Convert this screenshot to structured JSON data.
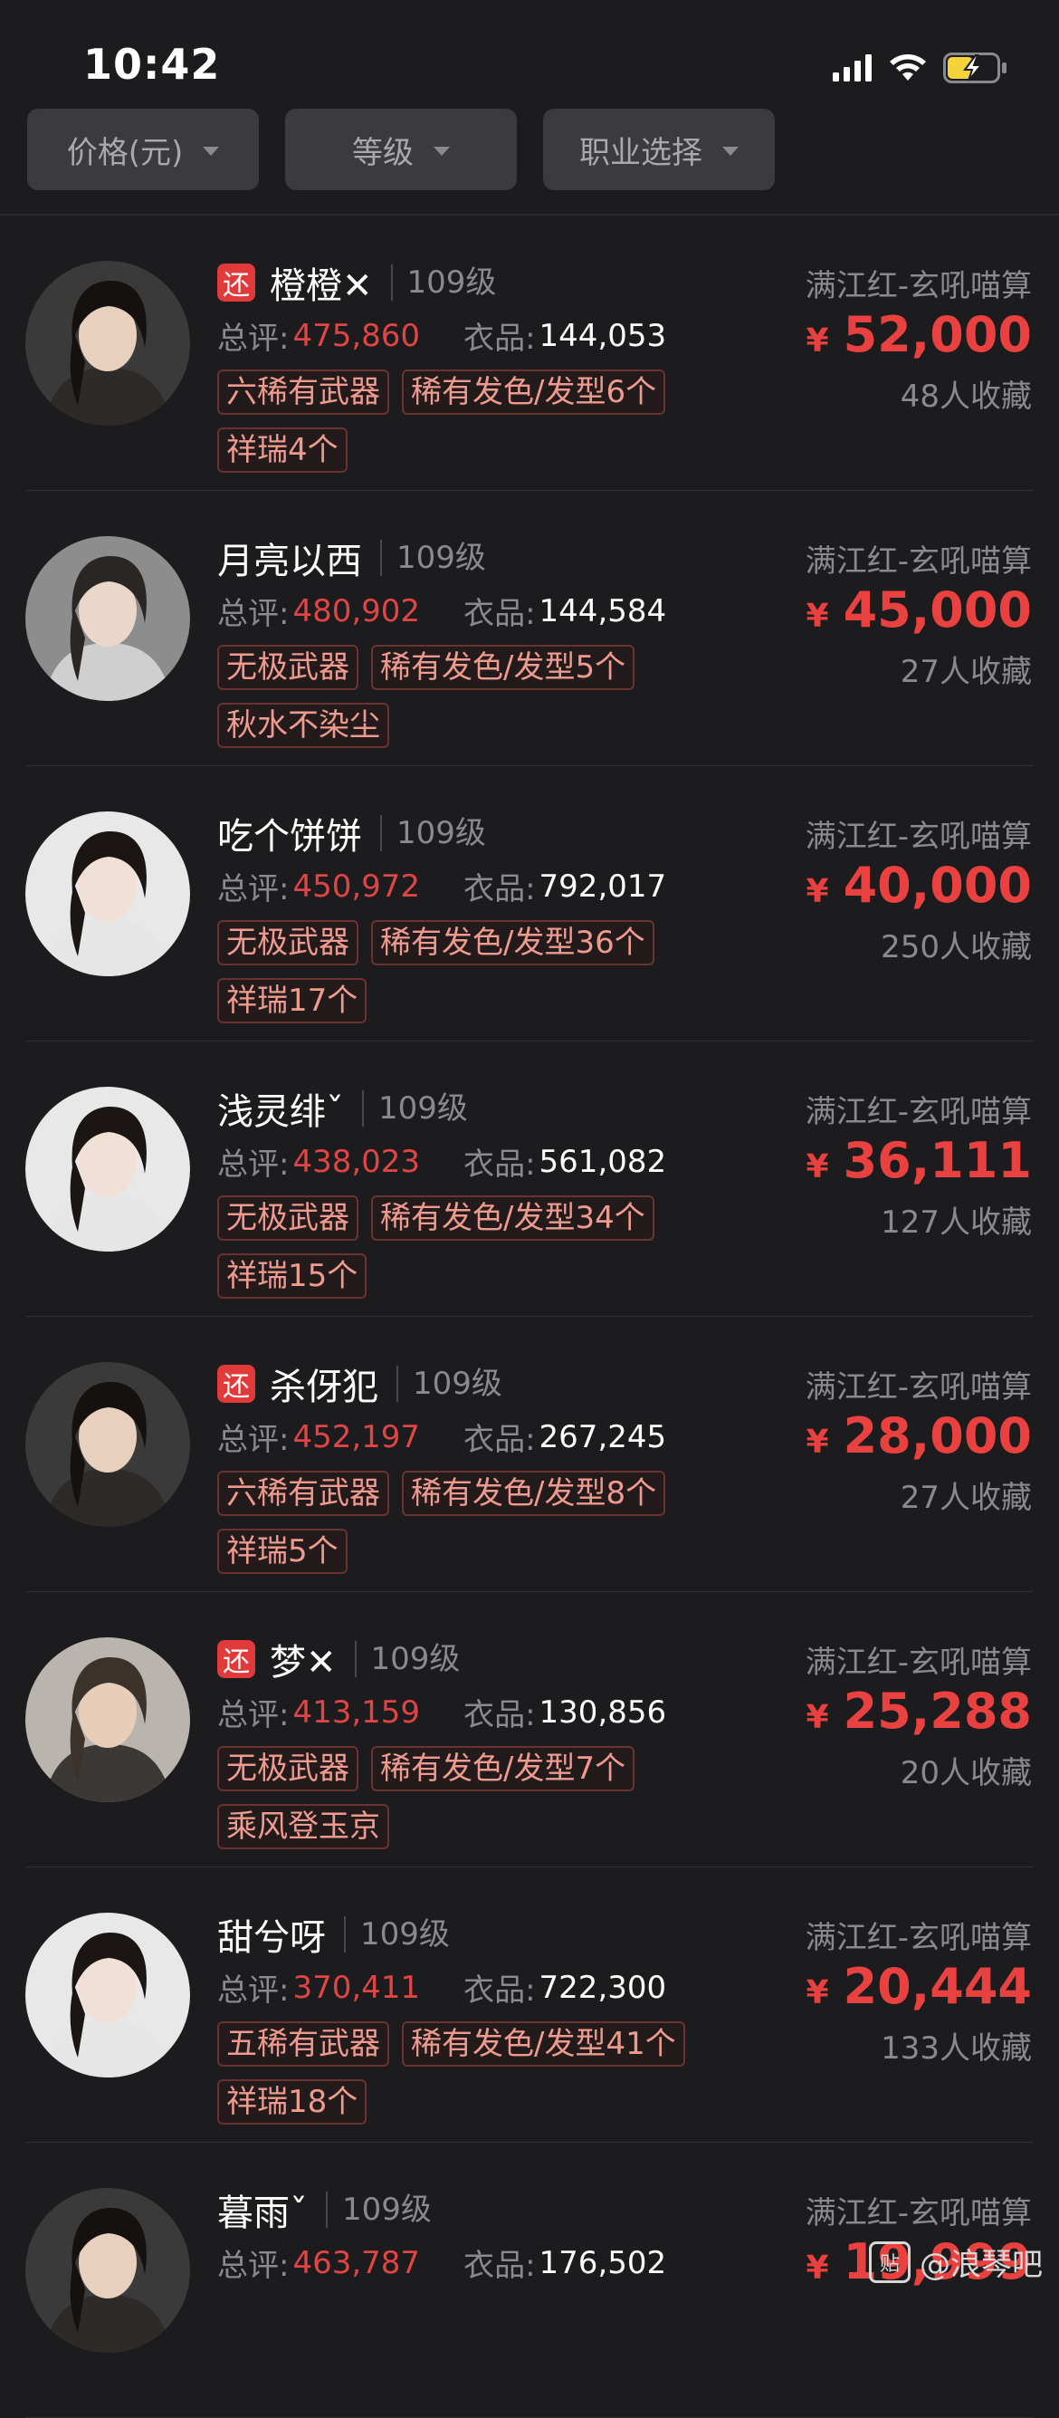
{
  "status_bar": {
    "time": "10:42"
  },
  "filters": [
    {
      "label": "价格(元)"
    },
    {
      "label": "等级"
    },
    {
      "label": "职业选择"
    }
  ],
  "items": [
    {
      "return_badge": "还",
      "name": "橙橙✕",
      "level": "109级",
      "score_label": "总评:",
      "score": "475,860",
      "cloth_label": "衣品:",
      "cloth": "144,053",
      "tags": [
        "六稀有武器",
        "稀有发色/发型6个",
        "祥瑞4个"
      ],
      "server": "满江红-玄吼喵算",
      "currency": "¥",
      "price": "52,000",
      "favorites": "48人收藏"
    },
    {
      "return_badge": "",
      "name": "月亮以西",
      "level": "109级",
      "score_label": "总评:",
      "score": "480,902",
      "cloth_label": "衣品:",
      "cloth": "144,584",
      "tags": [
        "无极武器",
        "稀有发色/发型5个",
        "秋水不染尘"
      ],
      "server": "满江红-玄吼喵算",
      "currency": "¥",
      "price": "45,000",
      "favorites": "27人收藏"
    },
    {
      "return_badge": "",
      "name": "吃个饼饼",
      "level": "109级",
      "score_label": "总评:",
      "score": "450,972",
      "cloth_label": "衣品:",
      "cloth": "792,017",
      "tags": [
        "无极武器",
        "稀有发色/发型36个",
        "祥瑞17个"
      ],
      "server": "满江红-玄吼喵算",
      "currency": "¥",
      "price": "40,000",
      "favorites": "250人收藏"
    },
    {
      "return_badge": "",
      "name": "浅灵绯ˇ",
      "level": "109级",
      "score_label": "总评:",
      "score": "438,023",
      "cloth_label": "衣品:",
      "cloth": "561,082",
      "tags": [
        "无极武器",
        "稀有发色/发型34个",
        "祥瑞15个"
      ],
      "server": "满江红-玄吼喵算",
      "currency": "¥",
      "price": "36,111",
      "favorites": "127人收藏"
    },
    {
      "return_badge": "还",
      "name": "杀伢犯",
      "level": "109级",
      "score_label": "总评:",
      "score": "452,197",
      "cloth_label": "衣品:",
      "cloth": "267,245",
      "tags": [
        "六稀有武器",
        "稀有发色/发型8个",
        "祥瑞5个"
      ],
      "server": "满江红-玄吼喵算",
      "currency": "¥",
      "price": "28,000",
      "favorites": "27人收藏"
    },
    {
      "return_badge": "还",
      "name": "梦✕",
      "level": "109级",
      "score_label": "总评:",
      "score": "413,159",
      "cloth_label": "衣品:",
      "cloth": "130,856",
      "tags": [
        "无极武器",
        "稀有发色/发型7个",
        "乘风登玉京"
      ],
      "server": "满江红-玄吼喵算",
      "currency": "¥",
      "price": "25,288",
      "favorites": "20人收藏"
    },
    {
      "return_badge": "",
      "name": "甜兮呀",
      "level": "109级",
      "score_label": "总评:",
      "score": "370,411",
      "cloth_label": "衣品:",
      "cloth": "722,300",
      "tags": [
        "五稀有武器",
        "稀有发色/发型41个",
        "祥瑞18个"
      ],
      "server": "满江红-玄吼喵算",
      "currency": "¥",
      "price": "20,444",
      "favorites": "133人收藏"
    },
    {
      "return_badge": "",
      "name": "暮雨ˇ",
      "level": "109级",
      "score_label": "总评:",
      "score": "463,787",
      "cloth_label": "衣品:",
      "cloth": "176,502",
      "tags": [],
      "server": "满江红-玄吼喵算",
      "currency": "¥",
      "price": "19,999",
      "favorites": ""
    }
  ],
  "watermark": {
    "text": "@浪琴吧",
    "icon_text": "贴"
  }
}
